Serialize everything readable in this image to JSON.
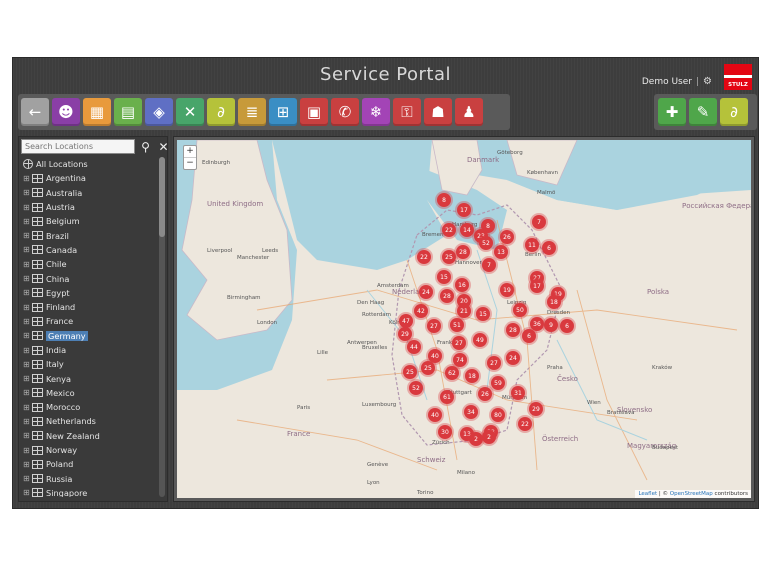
{
  "header": {
    "title": "Service Portal",
    "user": "Demo User",
    "separator": "|",
    "logo_text": "STULZ"
  },
  "toolbar": {
    "main": [
      {
        "name": "back-icon",
        "color": "#a1a1a1",
        "glyph": "←"
      },
      {
        "name": "users-icon",
        "color": "#8a3fa6",
        "glyph": "☻"
      },
      {
        "name": "map-icon",
        "color": "#e89a3c",
        "glyph": "▦"
      },
      {
        "name": "document-icon",
        "color": "#6ab04c",
        "glyph": "▤"
      },
      {
        "name": "cube-icon",
        "color": "#5f6fc4",
        "glyph": "◈"
      },
      {
        "name": "tools-icon",
        "color": "#48a56a",
        "glyph": "✕"
      },
      {
        "name": "paperclip-icon",
        "color": "#b5c23a",
        "glyph": "∂"
      },
      {
        "name": "list-icon",
        "color": "#c79a3a",
        "glyph": "≣"
      },
      {
        "name": "cart-icon",
        "color": "#3a8ec4",
        "glyph": "⊞"
      },
      {
        "name": "calendar-icon",
        "color": "#c94040",
        "glyph": "▣"
      },
      {
        "name": "phone-icon",
        "color": "#c94040",
        "glyph": "✆"
      },
      {
        "name": "snowflake-icon",
        "color": "#a344b6",
        "glyph": "❄"
      },
      {
        "name": "key-icon",
        "color": "#c94040",
        "glyph": "⚿"
      },
      {
        "name": "user-switch-icon",
        "color": "#c94040",
        "glyph": "☗"
      },
      {
        "name": "user-icon",
        "color": "#c94040",
        "glyph": "♟"
      }
    ],
    "actions": [
      {
        "name": "add-icon",
        "color": "#4fa64a",
        "glyph": "✚"
      },
      {
        "name": "edit-icon",
        "color": "#4fa64a",
        "glyph": "✎"
      },
      {
        "name": "attach-icon",
        "color": "#b5c23a",
        "glyph": "∂"
      }
    ]
  },
  "sidebar": {
    "search_placeholder": "Search Locations",
    "root": "All Locations",
    "selected": "Germany",
    "items": [
      "Argentina",
      "Australia",
      "Austria",
      "Belgium",
      "Brazil",
      "Canada",
      "Chile",
      "China",
      "Egypt",
      "Finland",
      "France",
      "Germany",
      "India",
      "Italy",
      "Kenya",
      "Mexico",
      "Morocco",
      "Netherlands",
      "New Zealand",
      "Norway",
      "Poland",
      "Russia",
      "Singapore"
    ]
  },
  "map": {
    "zoom_in": "+",
    "zoom_out": "−",
    "attribution_leaflet": "Leaflet",
    "attribution_osm": "OpenStreetMap",
    "attribution_suffix": "contributors",
    "country_labels": [
      "United Kingdom",
      "Danmark",
      "Nederland",
      "Polska",
      "Česko",
      "Österreich",
      "Schweiz",
      "France",
      "Slovensko",
      "Magyarország",
      "Российская Федерация"
    ],
    "city_labels": [
      "Edinburgh",
      "Leeds",
      "Liverpool",
      "Manchester",
      "Birmingham",
      "London",
      "Amsterdam",
      "Den Haag",
      "Rotterdam",
      "Antwerpen",
      "Bruxelles",
      "Lille",
      "Paris",
      "Luxembourg",
      "Hamburg",
      "Bremen",
      "Berlin",
      "Hannover",
      "Köln",
      "Frankfurt",
      "Leipzig",
      "Dresden",
      "Praha",
      "Wien",
      "Bratislava",
      "München",
      "Stuttgart",
      "Zürich",
      "Kraków",
      "Budapest",
      "Göteborg",
      "København",
      "Malmö",
      "Lyon",
      "Genève",
      "Torino",
      "Milano"
    ],
    "markers": [
      {
        "label": "8"
      },
      {
        "label": "17"
      },
      {
        "label": "22"
      },
      {
        "label": "14"
      },
      {
        "label": "8"
      },
      {
        "label": "7"
      },
      {
        "label": "23"
      },
      {
        "label": "52"
      },
      {
        "label": "26"
      },
      {
        "label": "11"
      },
      {
        "label": "6"
      },
      {
        "label": "22"
      },
      {
        "label": "25"
      },
      {
        "label": "28"
      },
      {
        "label": "13"
      },
      {
        "label": "7"
      },
      {
        "label": "15"
      },
      {
        "label": "16"
      },
      {
        "label": "27"
      },
      {
        "label": "24"
      },
      {
        "label": "28"
      },
      {
        "label": "20"
      },
      {
        "label": "19"
      },
      {
        "label": "17"
      },
      {
        "label": "19"
      },
      {
        "label": "21"
      },
      {
        "label": "42"
      },
      {
        "label": "50"
      },
      {
        "label": "18"
      },
      {
        "label": "47"
      },
      {
        "label": "27"
      },
      {
        "label": "51"
      },
      {
        "label": "15"
      },
      {
        "label": "28"
      },
      {
        "label": "36"
      },
      {
        "label": "6"
      },
      {
        "label": "29"
      },
      {
        "label": "44"
      },
      {
        "label": "27"
      },
      {
        "label": "49"
      },
      {
        "label": "6"
      },
      {
        "label": "40"
      },
      {
        "label": "74"
      },
      {
        "label": "27"
      },
      {
        "label": "24"
      },
      {
        "label": "25"
      },
      {
        "label": "25"
      },
      {
        "label": "62"
      },
      {
        "label": "18"
      },
      {
        "label": "59"
      },
      {
        "label": "52"
      },
      {
        "label": "61"
      },
      {
        "label": "26"
      },
      {
        "label": "31"
      },
      {
        "label": "40"
      },
      {
        "label": "34"
      },
      {
        "label": "80"
      },
      {
        "label": "29"
      },
      {
        "label": "30"
      },
      {
        "label": "13"
      },
      {
        "label": "33"
      },
      {
        "label": "22"
      },
      {
        "label": "2"
      },
      {
        "label": "2"
      },
      {
        "label": "9"
      }
    ]
  }
}
